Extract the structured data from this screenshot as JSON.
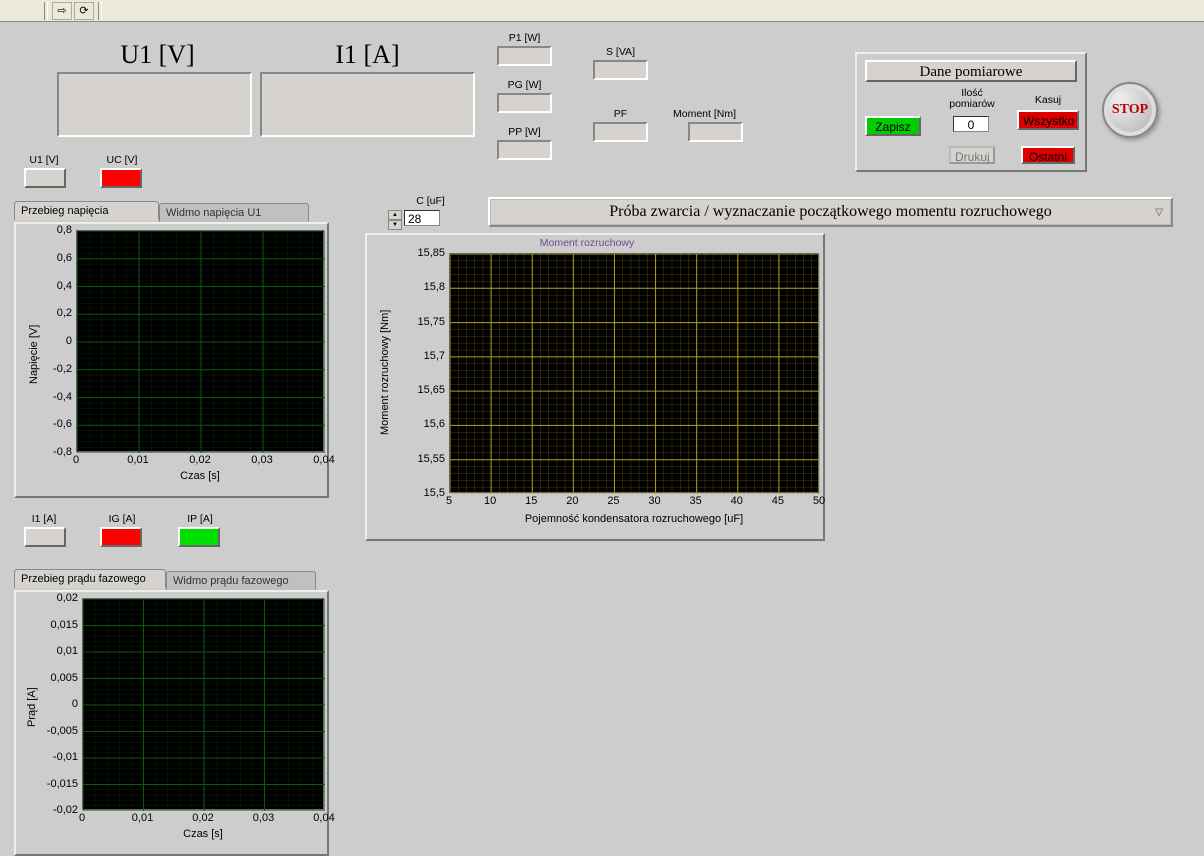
{
  "toolbar": {
    "run_icon": "⇨",
    "loop_icon": "⟳"
  },
  "big": {
    "u1_label": "U1 [V]",
    "i1_label": "I1 [A]"
  },
  "u_indicators": {
    "u1": {
      "label": "U1 [V]",
      "color": "#d6d3ce"
    },
    "uc": {
      "label": "UC [V]",
      "color": "#ff0000"
    }
  },
  "i_indicators": {
    "i1": {
      "label": "I1 [A]",
      "color": "#d6d3ce"
    },
    "ig": {
      "label": "IG [A]",
      "color": "#ff0000"
    },
    "ip": {
      "label": "IP [A]",
      "color": "#00e000"
    }
  },
  "power": {
    "p1": "P1 [W]",
    "pg": "PG [W]",
    "pp": "PP [W]",
    "s": "S [VA]",
    "pf": "PF",
    "moment": "Moment [Nm]"
  },
  "dane_panel": {
    "title": "Dane pomiarowe",
    "zapisz": "Zapisz",
    "ilosc_label": "Ilość\npomiarów",
    "ilosc_value": "0",
    "kasuj": "Kasuj",
    "wszystko": "Wszystko",
    "drukuj": "Drukuj",
    "ostatni": "Ostatni"
  },
  "stop": "STOP",
  "capacitance": {
    "label": "C [uF]",
    "value": "28"
  },
  "mode_dropdown": "Próba zwarcia / wyznaczanie początkowego momentu rozruchowego",
  "voltage_chart": {
    "tab1": "Przebieg napięcia",
    "tab2": "Widmo napięcia U1",
    "ylabel": "Napięcie [V]",
    "xlabel": "Czas [s]",
    "yticks": [
      "0,8",
      "0,6",
      "0,4",
      "0,2",
      "0",
      "-0,2",
      "-0,4",
      "-0,6",
      "-0,8"
    ],
    "xticks": [
      "0",
      "0,01",
      "0,02",
      "0,03",
      "0,04"
    ]
  },
  "current_chart": {
    "tab1": "Przebieg prądu fazowego",
    "tab2": "Widmo prądu fazowego",
    "ylabel": "Prąd [A]",
    "xlabel": "Czas [s]",
    "yticks": [
      "0,02",
      "0,015",
      "0,01",
      "0,005",
      "0",
      "-0,005",
      "-0,01",
      "-0,015",
      "-0,02"
    ],
    "xticks": [
      "0",
      "0,01",
      "0,02",
      "0,03",
      "0,04"
    ]
  },
  "moment_chart": {
    "title": "Moment rozruchowy",
    "ylabel": "Moment rozruchowy [Nm]",
    "xlabel": "Pojemność kondensatora rozruchowego [uF]",
    "yticks": [
      "15,85",
      "15,8",
      "15,75",
      "15,7",
      "15,65",
      "15,6",
      "15,55",
      "15,5"
    ],
    "xticks": [
      "5",
      "10",
      "15",
      "20",
      "25",
      "30",
      "35",
      "40",
      "45",
      "50"
    ]
  },
  "chart_data": [
    {
      "type": "line",
      "name": "voltage",
      "title": "Przebieg napięcia",
      "xlabel": "Czas [s]",
      "ylabel": "Napięcie [V]",
      "xlim": [
        0,
        0.04
      ],
      "ylim": [
        -0.8,
        0.8
      ],
      "x": [],
      "values": []
    },
    {
      "type": "line",
      "name": "current",
      "title": "Przebieg prądu fazowego",
      "xlabel": "Czas [s]",
      "ylabel": "Prąd [A]",
      "xlim": [
        0,
        0.04
      ],
      "ylim": [
        -0.02,
        0.02
      ],
      "x": [],
      "values": []
    },
    {
      "type": "line",
      "name": "moment",
      "title": "Moment rozruchowy",
      "xlabel": "Pojemność kondensatora rozruchowego [uF]",
      "ylabel": "Moment rozruchowy [Nm]",
      "xlim": [
        5,
        50
      ],
      "ylim": [
        15.5,
        15.85
      ],
      "x": [],
      "values": []
    }
  ]
}
